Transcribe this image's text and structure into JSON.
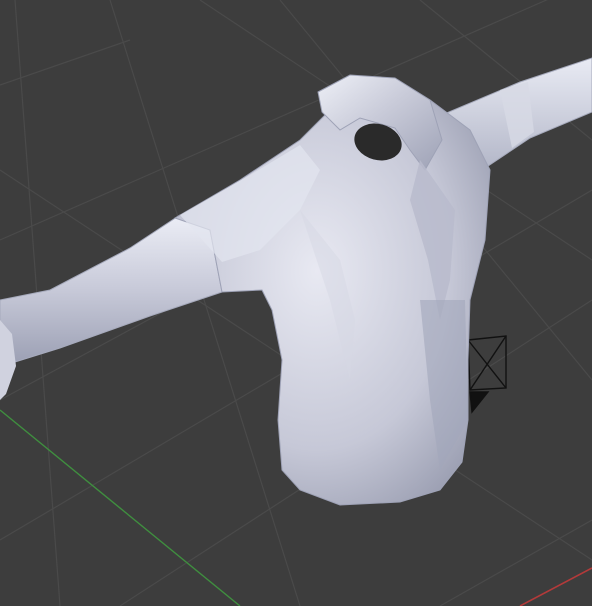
{
  "viewport": {
    "background": "#3d3d3d",
    "grid_color": "#4a4a4a",
    "axis_x_color": "#b33a3a",
    "axis_y_color": "#3f8f3f",
    "camera_color": "#111111"
  },
  "model": {
    "shirt_color": "#c9cbd9",
    "shirt_shadow": "#8f93a8",
    "shirt_highlight": "#eef0f7",
    "collar_interior": "#2a2a2a"
  }
}
